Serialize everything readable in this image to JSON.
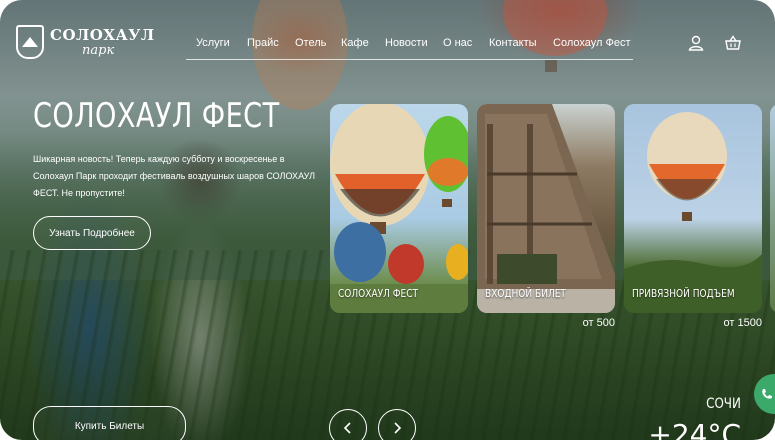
{
  "logo": {
    "main": "СОЛОХАУЛ",
    "sub": "парк"
  },
  "nav": {
    "items": [
      {
        "label": "Услуги"
      },
      {
        "label": "Прайс"
      },
      {
        "label": "Отель"
      },
      {
        "label": "Кафе"
      },
      {
        "label": "Новости"
      },
      {
        "label": "О нас"
      },
      {
        "label": "Контакты"
      },
      {
        "label": "Солохаул Фест"
      }
    ]
  },
  "header_icons": {
    "account": "user-icon",
    "cart": "basket-icon"
  },
  "hero": {
    "title": "СОЛОХАУЛ ФЕСТ",
    "text": "Шикарная новость! Теперь каждую субботу и воскресенье в Солохаул Парк проходит фестиваль воздушных шаров СОЛОХАУЛ ФЕСТ. Не пропустите!",
    "more_button": "Узнать Подробнее",
    "tickets_button": "Купить Билеты"
  },
  "cards": [
    {
      "label": "СОЛОХАУЛ ФЕСТ",
      "price": ""
    },
    {
      "label": "ВХОДНОЙ БИЛЕТ",
      "price": "от 500"
    },
    {
      "label": "ПРИВЯЗНОЙ ПОДЪЕМ",
      "price": "от 1500"
    }
  ],
  "carousel": {
    "prev_icon": "chevron-left-icon",
    "next_icon": "chevron-right-icon"
  },
  "weather": {
    "city": "СОЧИ",
    "temperature": "+24°C"
  },
  "colors": {
    "text": "#ffffff",
    "chat_button": "#3aa96a"
  }
}
